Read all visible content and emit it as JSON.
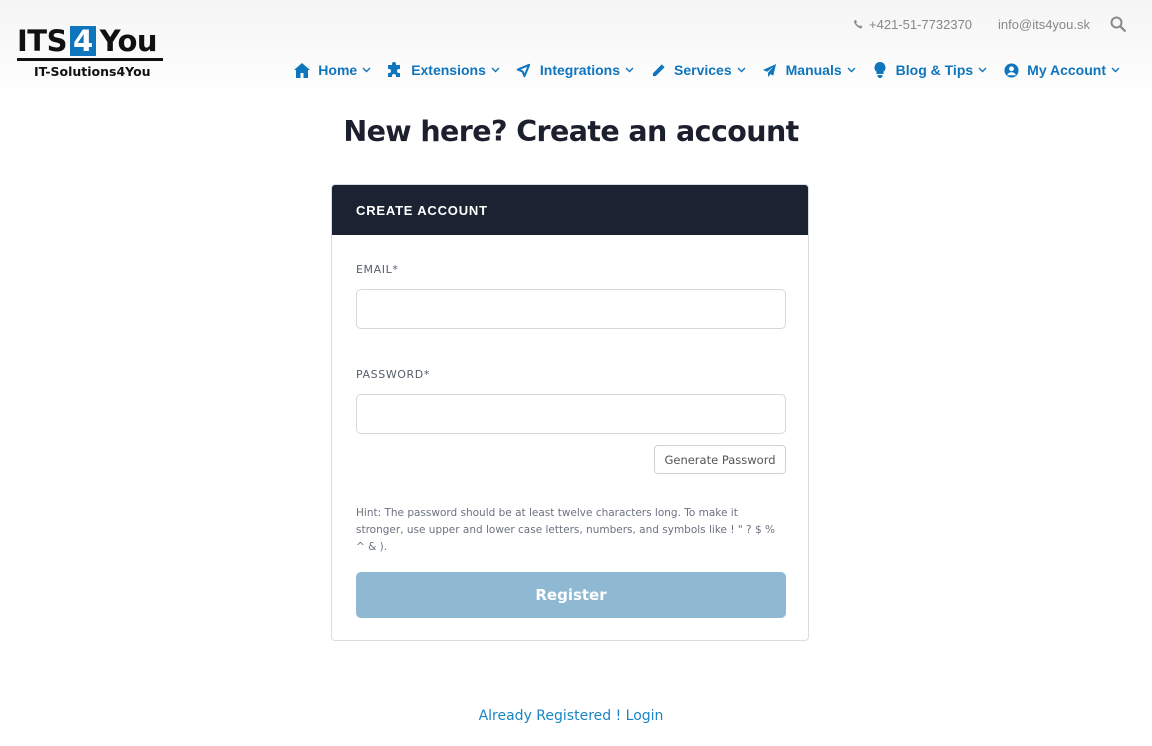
{
  "logo": {
    "its": "ITS",
    "four": "4",
    "you": "You",
    "subtitle": "IT-Solutions4You"
  },
  "contact": {
    "phone": "+421-51-7732370",
    "email": "info@its4you.sk",
    "search_icon": "search-icon"
  },
  "nav": [
    {
      "label": "Home",
      "icon": "home-icon"
    },
    {
      "label": "Extensions",
      "icon": "puzzle-icon"
    },
    {
      "label": "Integrations",
      "icon": "integrations-icon"
    },
    {
      "label": "Services",
      "icon": "pencil-icon"
    },
    {
      "label": "Manuals",
      "icon": "paper-plane-icon"
    },
    {
      "label": "Blog & Tips",
      "icon": "lightbulb-icon"
    },
    {
      "label": "My Account",
      "icon": "user-circle-icon"
    }
  ],
  "page": {
    "title": "New here? Create an account"
  },
  "form": {
    "header": "CREATE ACCOUNT",
    "email_label": "EMAIL*",
    "email_value": "",
    "password_label": "PASSWORD*",
    "password_value": "",
    "generate_label": "Generate Password",
    "hint": "Hint: The password should be at least twelve characters long. To make it stronger, use upper and lower case letters, numbers, and symbols like ! \" ? $ % ^ & ).",
    "register_label": "Register"
  },
  "footer": {
    "login_link": "Already Registered ! Login"
  },
  "colors": {
    "brand": "#0f75bc",
    "header_bg": "#1b2333",
    "register_disabled": "#8fb8d2",
    "link": "#1b85c4"
  }
}
